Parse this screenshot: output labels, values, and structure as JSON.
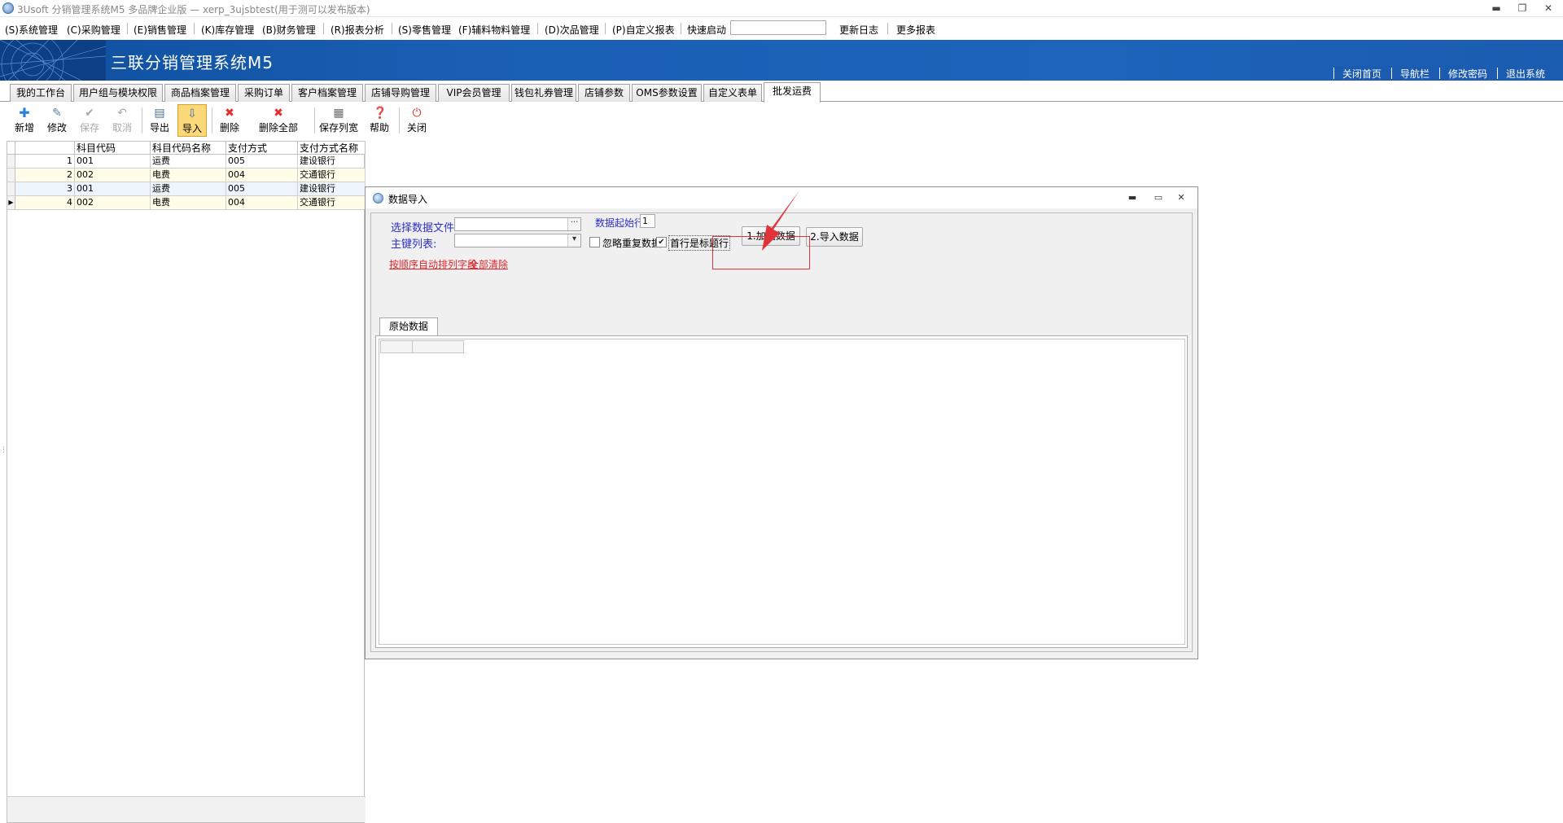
{
  "window": {
    "title": "3Usoft 分销管理系统M5 多品牌企业版 — xerp_3ujsbtest(用于测可以发布版本)"
  },
  "menu": {
    "items": [
      "(S)系统管理",
      "(C)采购管理",
      "(E)销售管理",
      "(K)库存管理",
      "(B)财务管理",
      "(R)报表分析",
      "(S)零售管理",
      "(F)辅料物料管理",
      "(D)次品管理",
      "(P)自定义报表"
    ],
    "quick_launch_label": "快速启动",
    "changelog": "更新日志",
    "more_reports": "更多报表"
  },
  "banner": {
    "app_name": "三联分销管理系统M5",
    "links": [
      "关闭首页",
      "导航栏",
      "修改密码",
      "退出系统"
    ]
  },
  "tabs": [
    "我的工作台",
    "用户组与模块权限",
    "商品档案管理",
    "采购订单",
    "客户档案管理",
    "店铺导购管理",
    "VIP会员管理",
    "钱包礼券管理",
    "店铺参数",
    "OMS参数设置",
    "自定义表单",
    "批发运费"
  ],
  "active_tab": "批发运费",
  "toolbar": {
    "new": "新增",
    "edit": "修改",
    "save": "保存",
    "cancel": "取消",
    "export": "导出",
    "import": "导入",
    "delete": "删除",
    "delete_all": "删除全部",
    "save_cols": "保存列宽",
    "help": "帮助",
    "close": "关闭"
  },
  "grid": {
    "columns": [
      "科目代码",
      "科目代码名称",
      "支付方式",
      "支付方式名称"
    ],
    "rows": [
      {
        "n": "1",
        "code": "001",
        "name": "运费",
        "pay": "005",
        "payname": "建设银行"
      },
      {
        "n": "2",
        "code": "002",
        "name": "电费",
        "pay": "004",
        "payname": "交通银行"
      },
      {
        "n": "3",
        "code": "001",
        "name": "运费",
        "pay": "005",
        "payname": "建设银行"
      },
      {
        "n": "4",
        "code": "002",
        "name": "电费",
        "pay": "004",
        "payname": "交通银行"
      }
    ]
  },
  "dialog": {
    "title": "数据导入",
    "select_file_label": "选择数据文件:",
    "key_list_label": "主键列表:",
    "start_row_label": "数据起始行",
    "start_row_value": "1",
    "ignore_dup_label": "忽略重复数据",
    "first_row_header_label": "首行是标题行",
    "load_btn": "1.加载数据",
    "import_btn": "2.导入数据",
    "auto_sort_link": "按顺序自动排列字段",
    "clear_all_link": "全部清除",
    "raw_data_tab": "原始数据",
    "ellipsis": "···"
  },
  "colors": {
    "banner": "#1a5fb4",
    "label_blue": "#2e2ecb",
    "link_red": "#e0242a",
    "annotation_red": "#e0343a"
  }
}
